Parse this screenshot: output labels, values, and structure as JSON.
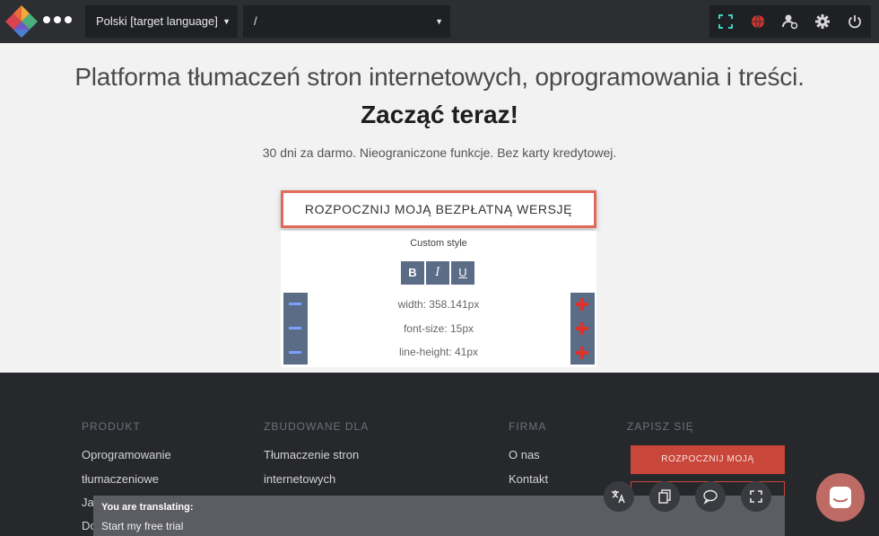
{
  "toolbar": {
    "language_select": "Polski [target language]",
    "path_select": "/",
    "icons": [
      "fullscreen-icon",
      "globe-icon",
      "user-settings-icon",
      "gear-icon",
      "power-icon"
    ]
  },
  "hero": {
    "title": "Platforma tłumaczeń stron internetowych, oprogramowania i treści.",
    "subtitle": "Zacząć teraz!",
    "note": "30 dni za darmo. Nieograniczone funkcje. Bez karty kredytowej."
  },
  "cta": {
    "label": "ROZPOCZNIJ MOJĄ BEZPŁATNĄ WERSJĘ"
  },
  "style_panel": {
    "title": "Custom style",
    "bold": "B",
    "italic": "I",
    "underline": "U",
    "width": "width: 358.141px",
    "font_size": "font-size: 15px",
    "line_height": "line-height: 41px"
  },
  "footer": {
    "columns": [
      {
        "heading": "PRODUKT",
        "links": [
          "Oprogramowanie",
          "tłumaczeniowe",
          "Ja",
          "Do"
        ]
      },
      {
        "heading": "ZBUDOWANE DLA",
        "links": [
          "Tłumaczenie stron",
          "internetowych"
        ]
      },
      {
        "heading": "FIRMA",
        "links": [
          "O nas",
          "Kontakt"
        ]
      },
      {
        "heading": "ZAPISZ SIĘ",
        "links": []
      }
    ],
    "signup_button": "ROZPOCZNIJ MOJĄ"
  },
  "translating": {
    "label": "You are translating:",
    "text": "Start my free trial"
  },
  "colors": {
    "toolbar_bg": "#2d2e32",
    "accent": "#e06b5b",
    "footer_bg": "#27282c",
    "panel_button": "#5b6c87",
    "chat_bubble": "#bd6b64"
  }
}
